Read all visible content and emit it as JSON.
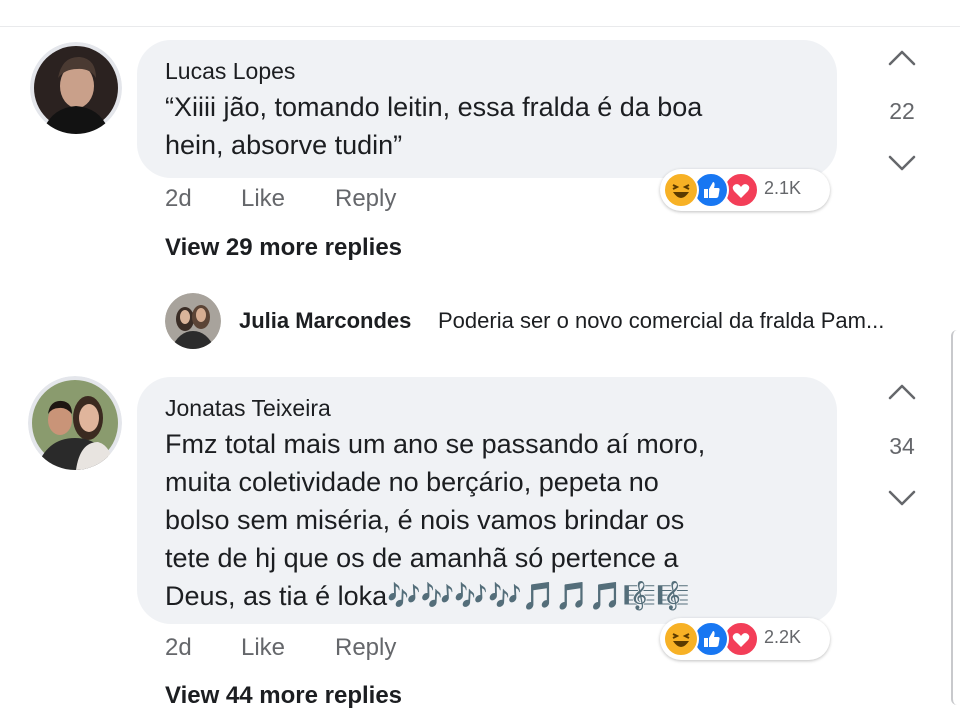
{
  "comments": [
    {
      "author": "Lucas Lopes",
      "lines": [
        "“Xiiii jão, tomando leitin, essa fralda é da boa",
        "hein, absorve tudin”"
      ],
      "score": "22",
      "time": "2d",
      "like_label": "Like",
      "reply_label": "Reply",
      "reaction_icons": [
        "haha-icon",
        "like-icon",
        "love-icon"
      ],
      "reaction_count": "2.1K",
      "view_more": "View 29 more replies",
      "preview_reply": {
        "author": "Julia Marcondes",
        "snippet": "Poderia ser o novo comercial da fralda Pam..."
      }
    },
    {
      "author": "Jonatas Teixeira",
      "lines": [
        "Fmz total mais um ano se passando aí moro,",
        "muita coletividade no berçário, pepeta no",
        "bolso sem miséria, é nois vamos brindar os",
        "tete de hj que os de amanhã só pertence a",
        "Deus, as tia é loka🎶🎶🎶🎶🎵🎵🎵🎼🎼"
      ],
      "score": "34",
      "time": "2d",
      "like_label": "Like",
      "reply_label": "Reply",
      "reaction_icons": [
        "haha-icon",
        "like-icon",
        "love-icon"
      ],
      "reaction_count": "2.2K",
      "view_more": "View 44 more replies"
    }
  ],
  "colors": {
    "bubble": "#f0f2f5",
    "text": "#1c1e21",
    "secondary": "#65676b",
    "like_blue": "#1877f2",
    "love_red": "#f33e58",
    "haha_yellow": "#f7b125"
  }
}
